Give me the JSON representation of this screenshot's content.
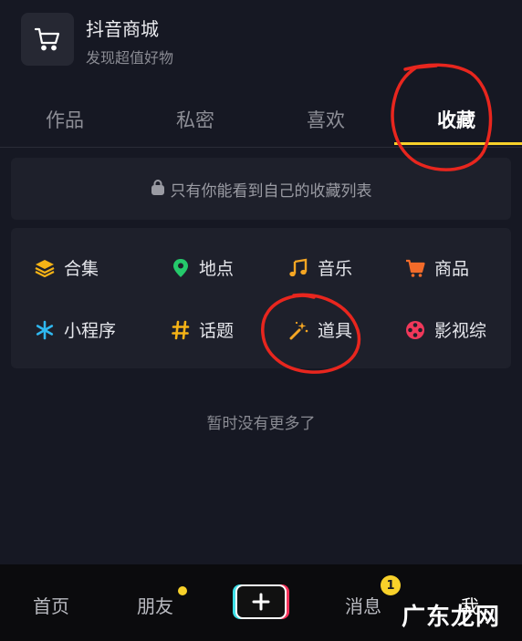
{
  "shop": {
    "title": "抖音商城",
    "subtitle": "发现超值好物",
    "icon": "shopping-cart-icon"
  },
  "tabs": [
    {
      "label": "作品"
    },
    {
      "label": "私密"
    },
    {
      "label": "喜欢"
    },
    {
      "label": "收藏",
      "active": true
    }
  ],
  "privacy_notice": {
    "text": "只有你能看到自己的收藏列表",
    "icon": "lock-icon"
  },
  "categories": [
    {
      "label": "合集",
      "icon": "layers-icon",
      "color": "#f5b316"
    },
    {
      "label": "地点",
      "icon": "location-pin-icon",
      "color": "#25c96b"
    },
    {
      "label": "音乐",
      "icon": "music-note-icon",
      "color": "#f5a623"
    },
    {
      "label": "商品",
      "icon": "cart-icon",
      "color": "#f26b2a"
    },
    {
      "label": "小程序",
      "icon": "asterisk-icon",
      "color": "#2fb8f0"
    },
    {
      "label": "话题",
      "icon": "hashtag-icon",
      "color": "#f5b316"
    },
    {
      "label": "道具",
      "icon": "magic-wand-icon",
      "color": "#f5a623"
    },
    {
      "label": "影视综",
      "icon": "film-reel-icon",
      "color": "#f0385a"
    }
  ],
  "empty_text": "暂时没有更多了",
  "bottom_nav": {
    "home": "首页",
    "friends": "朋友",
    "messages": "消息",
    "message_badge": "1",
    "me": "我"
  },
  "watermark": "广东龙网",
  "colors": {
    "background": "#161823",
    "accent": "#f8d12a",
    "annotation": "#e8261e"
  }
}
